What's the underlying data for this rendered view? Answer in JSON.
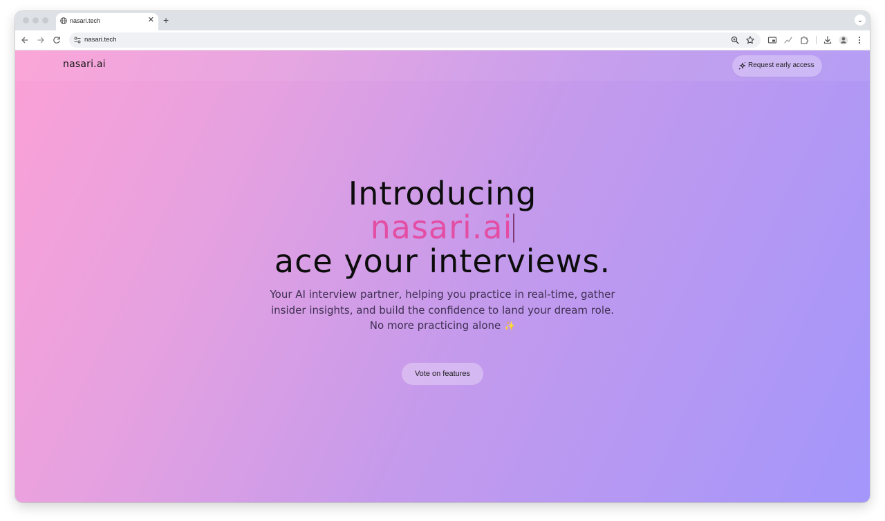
{
  "browser": {
    "tab": {
      "title": "nasari.tech",
      "close_glyph": "✕",
      "favicon": "globe-icon"
    },
    "new_tab_glyph": "+",
    "tab_menu_glyph": "⌄",
    "address_bar": {
      "url": "nasari.tech"
    },
    "toolbar_icons": [
      "back-icon",
      "forward-icon",
      "reload-icon",
      "site-info-icon",
      "zoom-icon",
      "bookmark-star-icon",
      "picture-in-picture-icon",
      "extension-pulse-icon",
      "extensions-puzzle-icon",
      "download-icon",
      "profile-avatar-icon",
      "more-menu-icon"
    ]
  },
  "site": {
    "brand": "nasari.ai",
    "header_button": {
      "label": "Request early access",
      "icon": "sparkle-icon"
    },
    "hero": {
      "line1": "Introducing",
      "line2": "nasari.ai",
      "line3": "ace your interviews."
    },
    "subtitle": {
      "line1": "Your AI interview partner, helping you practice in real-time, gather",
      "line2": "insider insights, and build the confidence to land your dream role.",
      "line3": "No more practicing alone",
      "emoji": "✨"
    },
    "cta_button": {
      "label": "Vote on features"
    }
  },
  "colors": {
    "gradient_start": "#fba1d6",
    "gradient_mid": "#c49aec",
    "gradient_end": "#a396fb",
    "accent_pink": "#e34ea4",
    "heading": "#0c0c0c",
    "subtitle": "#3f2f52"
  }
}
